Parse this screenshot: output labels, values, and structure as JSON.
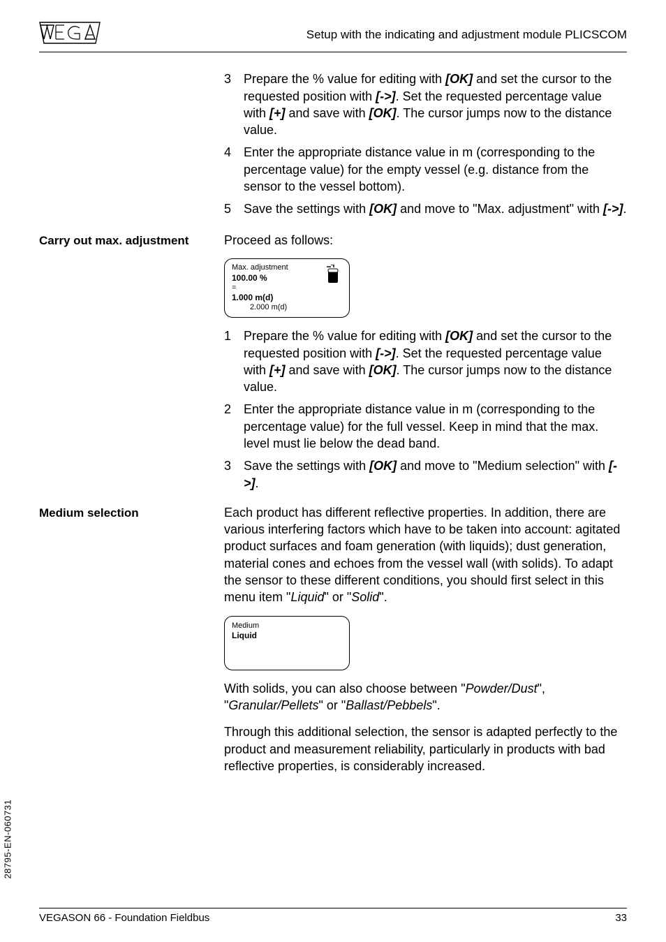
{
  "header": {
    "title": "Setup with the indicating and adjustment module PLICSCOM"
  },
  "sections": {
    "top_list": [
      {
        "n": "3",
        "parts": [
          "Prepare the % value for editing with ",
          {
            "b": "[OK]"
          },
          " and set the cursor to the requested position with ",
          {
            "b": "[->]"
          },
          ". Set the requested percentage value with ",
          {
            "b": "[+]"
          },
          " and save with ",
          {
            "b": "[OK]"
          },
          ". The cursor jumps now to the distance value."
        ]
      },
      {
        "n": "4",
        "parts": [
          "Enter the appropriate distance value in m (corresponding to the percentage value) for the empty vessel (e.g. distance from the sensor to the vessel bottom)."
        ]
      },
      {
        "n": "5",
        "parts": [
          "Save the settings with ",
          {
            "b": "[OK]"
          },
          " and move to \"Max. adjustment\" with ",
          {
            "b": "[->]"
          },
          "."
        ]
      }
    ],
    "max_adj": {
      "label": "Carry out max. adjustment",
      "intro": "Proceed as follows:",
      "lcd": {
        "title": "Max. adjustment",
        "pct": "100.00 %",
        "eq": "=",
        "dist": "1.000 m(d)",
        "alt": "2.000 m(d)"
      },
      "list": [
        {
          "n": "1",
          "parts": [
            "Prepare the % value for editing with ",
            {
              "b": "[OK]"
            },
            " and set the cursor to the requested position with ",
            {
              "b": "[->]"
            },
            ". Set the requested percentage value with ",
            {
              "b": "[+]"
            },
            " and save with ",
            {
              "b": "[OK]"
            },
            ". The cursor jumps now to the distance value."
          ]
        },
        {
          "n": "2",
          "parts": [
            "Enter the appropriate distance value in m (corresponding to the percentage value) for the full vessel. Keep in mind that the max. level must lie below the dead band."
          ]
        },
        {
          "n": "3",
          "parts": [
            "Save the settings with ",
            {
              "b": "[OK]"
            },
            " and move to \"Medium selection\" with ",
            {
              "b": "[->]"
            },
            "."
          ]
        }
      ]
    },
    "medium": {
      "label": "Medium selection",
      "para1_parts": [
        "Each product has different reflective properties. In addition, there are various interfering factors which have to be taken into account: agitated product surfaces and foam generation (with liquids); dust generation, material cones and echoes from the vessel wall (with solids). To adapt the sensor to these different conditions, you should first select in this menu item \"",
        {
          "i": "Liquid"
        },
        "\" or \"",
        {
          "i": "Solid"
        },
        "\"."
      ],
      "lcd": {
        "title": "Medium",
        "value": "Liquid"
      },
      "para2_parts": [
        "With solids, you can also choose between \"",
        {
          "i": "Powder/Dust"
        },
        "\", \"",
        {
          "i": "Granular/Pellets"
        },
        "\" or \"",
        {
          "i": "Ballast/Pebbels"
        },
        "\"."
      ],
      "para3": "Through this additional selection, the sensor is adapted perfectly to the product and measurement reliability, particularly in products with bad reflective properties, is considerably increased."
    }
  },
  "footer": {
    "left": "VEGASON 66 - Foundation Fieldbus",
    "right": "33"
  },
  "doc_id": "28795-EN-060731"
}
